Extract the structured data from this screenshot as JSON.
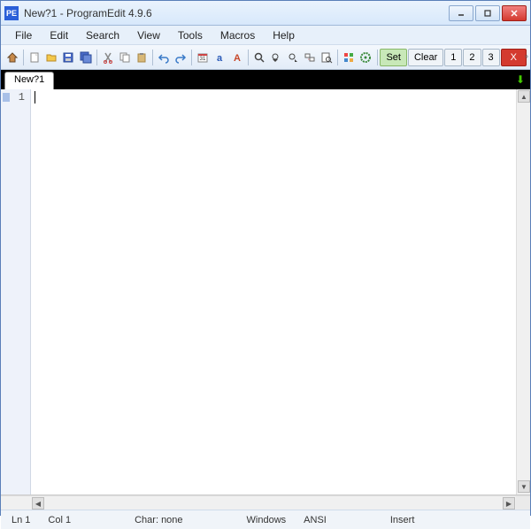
{
  "title": "New?1  -  ProgramEdit 4.9.6",
  "app_icon_text": "PE",
  "menu": [
    "File",
    "Edit",
    "Search",
    "View",
    "Tools",
    "Macros",
    "Help"
  ],
  "toolbar_labels": {
    "set": "Set",
    "clear": "Clear",
    "b1": "1",
    "b2": "2",
    "b3": "3",
    "x": "X"
  },
  "tab": {
    "label": "New?1"
  },
  "gutter": {
    "line1": "1"
  },
  "status": {
    "ln": "Ln 1",
    "col": "Col 1",
    "char": "Char: none",
    "platform": "Windows",
    "encoding": "ANSI",
    "mode": "Insert"
  }
}
